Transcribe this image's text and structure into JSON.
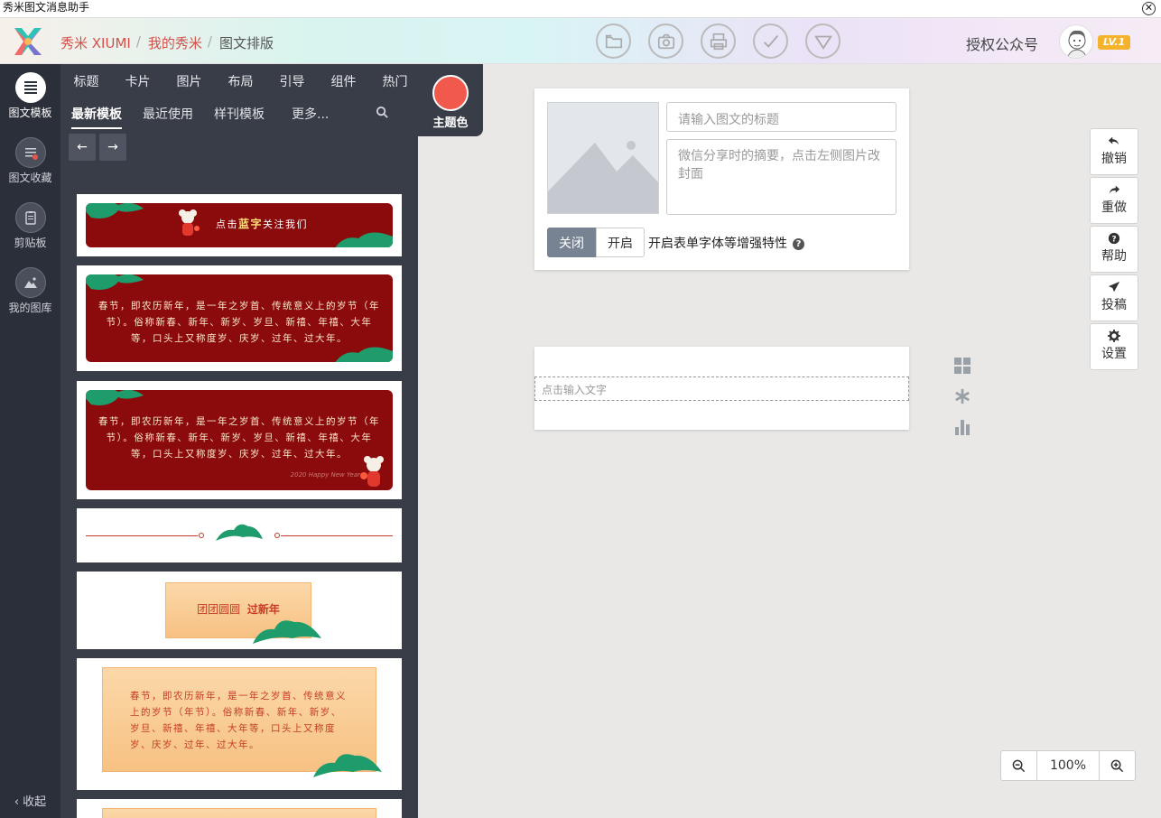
{
  "window": {
    "title": "秀米图文消息助手",
    "close_symbol": "✕"
  },
  "header": {
    "breadcrumbs": [
      "秀米 XIUMI",
      "我的秀米",
      "图文排版"
    ],
    "separator": "/",
    "tool_icons": [
      "folder-icon",
      "camera-icon",
      "print-icon",
      "check-icon",
      "triangle-icon"
    ],
    "auth_label": "授权公众号",
    "level_badge": "LV.1"
  },
  "rail": {
    "items": [
      {
        "label": "图文模板",
        "icon": "template-icon",
        "active": true
      },
      {
        "label": "图文收藏",
        "icon": "favorites-icon",
        "active": false
      },
      {
        "label": "剪贴板",
        "icon": "clipboard-icon",
        "active": false
      },
      {
        "label": "我的图库",
        "icon": "gallery-icon",
        "active": false
      }
    ],
    "collapse_label": "收起"
  },
  "panel": {
    "categories": [
      "标题",
      "卡片",
      "图片",
      "布局",
      "引导",
      "组件",
      "热门"
    ],
    "subtabs": [
      "最新模板",
      "最近使用",
      "样刊模板",
      "更多..."
    ],
    "active_subtab": "最新模板"
  },
  "theme": {
    "label": "主题色",
    "color": "#f0594c"
  },
  "templates": {
    "banner1": {
      "pre": "点击",
      "bold": "蓝字",
      "post": "关注我们"
    },
    "paragraph": "春节，即农历新年，是一年之岁首、传统意义上的岁节（年节）。俗称新春、新年、新岁、岁旦、新禧、年禧、大年等，口头上又称度岁、庆岁、过年、过大年。",
    "watermark": "2020 Happy New Year",
    "scroll_title_pre": "团团圆圆",
    "scroll_title_bold": "过新年"
  },
  "editor": {
    "title_placeholder": "请输入图文的标题",
    "abstract_placeholder": "微信分享时的摘要，点击左侧图片改封面",
    "toggle_off": "关闭",
    "toggle_on": "开启",
    "toggle_label": "开启表单字体等增强特性",
    "text_placeholder": "点击输入文字"
  },
  "actions": [
    {
      "label": "撤销",
      "icon": "undo-icon"
    },
    {
      "label": "重做",
      "icon": "redo-icon"
    },
    {
      "label": "帮助",
      "icon": "help-icon"
    },
    {
      "label": "投稿",
      "icon": "send-icon"
    },
    {
      "label": "设置",
      "icon": "gear-icon"
    }
  ],
  "zoom": {
    "value": "100%"
  }
}
